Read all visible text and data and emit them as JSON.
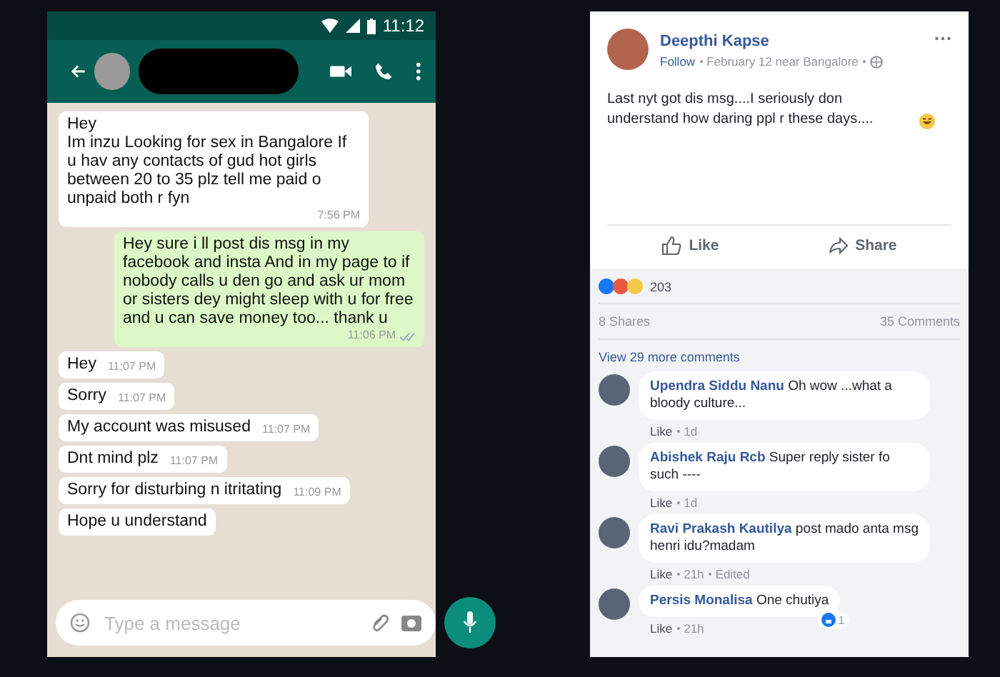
{
  "chat": {
    "status_time": "11:12",
    "messages": [
      {
        "kind": "incoming",
        "text": "Hey\nIm inzu Looking for sex in Bangalore If u hav any contacts of gud hot girls between 20 to 35 plz tell me paid o unpaid both r fyn",
        "time": "7:56 PM"
      },
      {
        "kind": "outgoing",
        "text": "Hey sure i ll post dis msg in my facebook and insta And in my page to if nobody calls u den go and ask ur mom or sisters dey might sleep with u for free and u can save money too... thank u",
        "time": "11:06 PM",
        "delivered": true
      },
      {
        "kind": "incoming",
        "text": "Hey",
        "time": "11:07 PM"
      },
      {
        "kind": "incoming",
        "text": "Sorry",
        "time": "11:07 PM"
      },
      {
        "kind": "incoming",
        "text": "My account was misused",
        "time": "11:07 PM"
      },
      {
        "kind": "incoming",
        "text": "Dnt mind plz",
        "time": "11:07 PM"
      },
      {
        "kind": "incoming",
        "text": "Sorry for disturbing n itritating",
        "time": "11:09 PM"
      },
      {
        "kind": "incoming",
        "text": "Hope u understand"
      }
    ],
    "input": {
      "placeholder": "Type a message"
    }
  },
  "post": {
    "author": "Deepthi Kapse",
    "follow": "Follow",
    "meta": "February 12 near Bangalore",
    "text": "Last nyt got dis msg....I seriously don understand how daring ppl r these days....",
    "actions": [
      {
        "kind": "like",
        "label": "Like"
      },
      {
        "kind": "share",
        "label": "Share"
      }
    ],
    "reactions_count": "203",
    "shares": "8 Shares",
    "comments_count": "35 Comments",
    "view_more": "View 29 more comments",
    "comments": [
      {
        "name": "Upendra Siddu Nanu",
        "text": "Oh wow ...what a bloody culture...",
        "like": "Like",
        "time": "1d"
      },
      {
        "name": "Abishek Raju Rcb",
        "text": "Super reply sister fo such ----",
        "like": "Like",
        "time": "1d"
      },
      {
        "name": "Ravi Prakash Kautilya",
        "text": "post mado anta msg henri idu?madam",
        "like": "Like",
        "time": "21h",
        "edited": "Edited"
      },
      {
        "name": "Persis Monalisa",
        "text": "One chutiya",
        "like": "Like",
        "time": "21h",
        "likes": "1"
      }
    ]
  }
}
